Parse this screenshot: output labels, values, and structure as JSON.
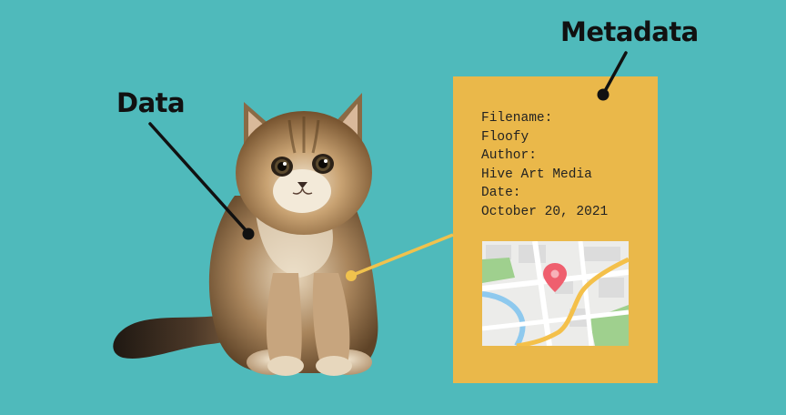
{
  "labels": {
    "data": "Data",
    "metadata": "Metadata"
  },
  "metadata_card": {
    "lines": [
      "Filename:",
      "Floofy",
      "Author:",
      "Hive Art Media",
      "Date:",
      "October 20, 2021"
    ]
  },
  "icons": {
    "subject": "kitten-illustration",
    "map": "map-with-location-pin-icon"
  },
  "colors": {
    "background": "#4fbabb",
    "card": "#eab84a",
    "connector": "#f0c24d",
    "pointer": "#111111",
    "map_pin": "#ef5f6e",
    "map_route": "#f4c04a",
    "map_water": "#8ec9ee",
    "map_park": "#9fd08e"
  }
}
